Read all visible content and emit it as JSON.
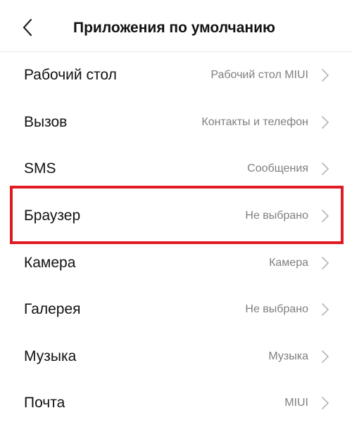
{
  "header": {
    "title": "Приложения по умолчанию",
    "back_icon": "chevron-left-icon"
  },
  "items": [
    {
      "label": "Рабочий стол",
      "value": "Рабочий стол MIUI"
    },
    {
      "label": "Вызов",
      "value": "Контакты и телефон"
    },
    {
      "label": "SMS",
      "value": "Сообщения"
    },
    {
      "label": "Браузер",
      "value": "Не выбрано"
    },
    {
      "label": "Камера",
      "value": "Камера"
    },
    {
      "label": "Галерея",
      "value": "Не выбрано"
    },
    {
      "label": "Музыка",
      "value": "Музыка"
    },
    {
      "label": "Почта",
      "value": "MIUI"
    }
  ],
  "colors": {
    "highlight": "#e01b24",
    "secondary_text": "#7f7f7f",
    "chevron": "#b5b5b5"
  }
}
